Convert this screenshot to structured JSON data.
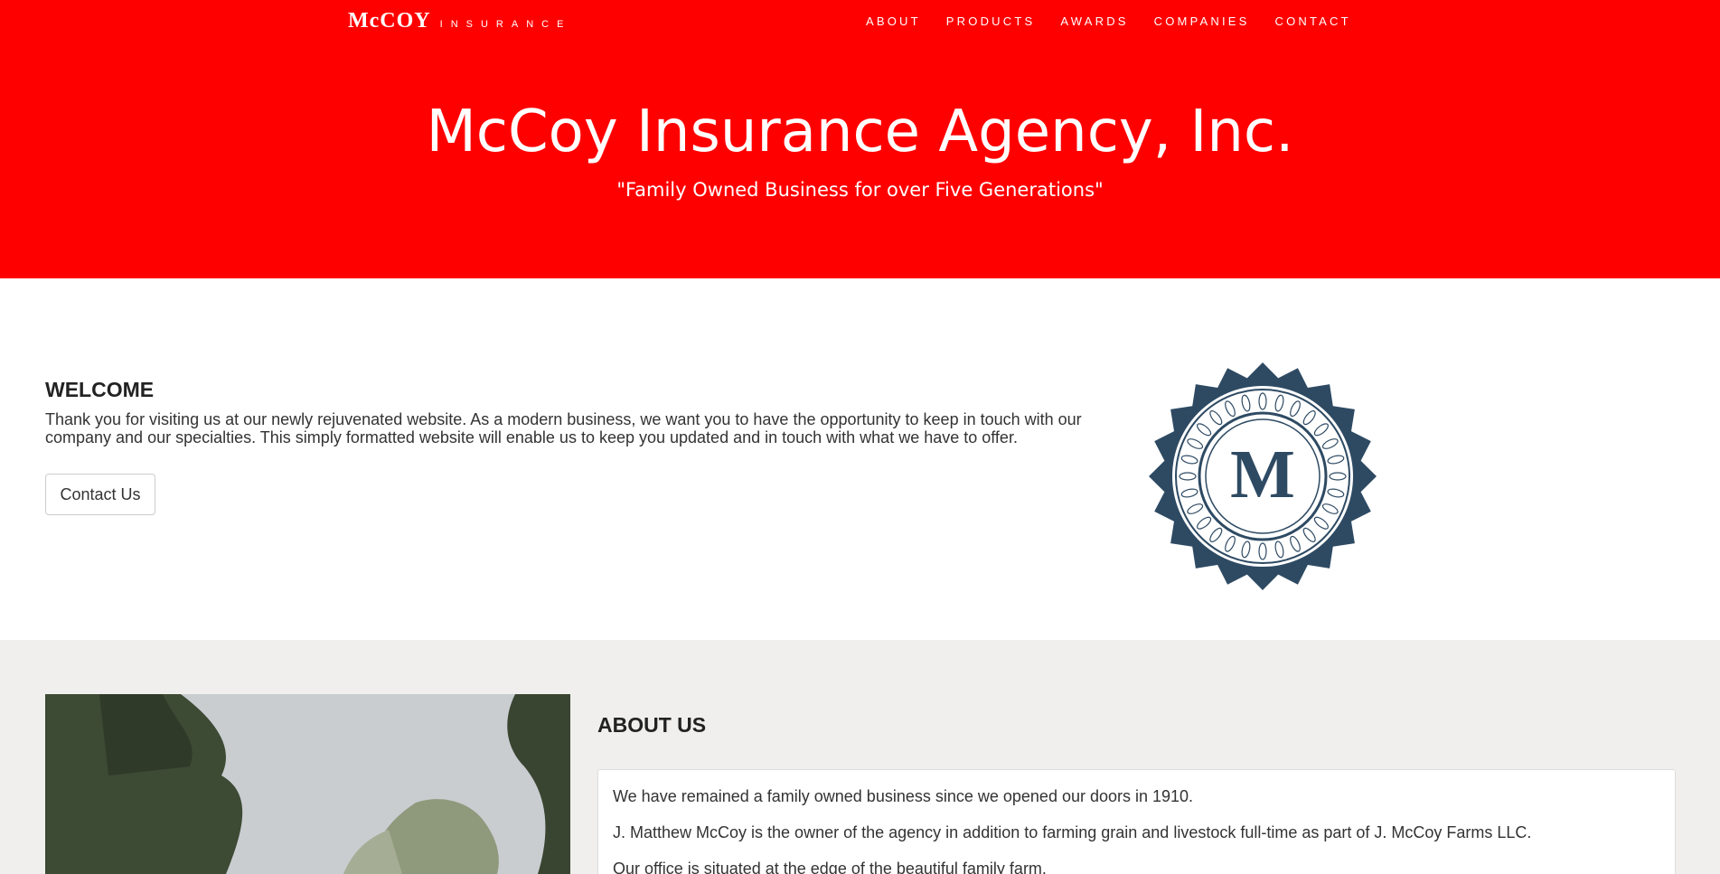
{
  "header": {
    "logo_mccoy": "McCOY",
    "logo_insurance": "INSURANCE",
    "nav": [
      {
        "label": "ABOUT"
      },
      {
        "label": "PRODUCTS"
      },
      {
        "label": "AWARDS"
      },
      {
        "label": "COMPANIES"
      },
      {
        "label": "CONTACT"
      }
    ]
  },
  "hero": {
    "title": "McCoy Insurance Agency, Inc.",
    "subtitle": "\"Family Owned Business for over Five Generations\""
  },
  "welcome": {
    "heading": "WELCOME",
    "text": "Thank you for visiting us at our newly rejuvenated website. As a modern business, we want you to have the opportunity to keep in touch with our company and our specialties. This simply formatted website will enable us to keep you updated and in touch with what we have to offer.",
    "button_label": "Contact Us",
    "seal_letter": "M"
  },
  "about": {
    "heading": "ABOUT US",
    "paragraphs": [
      "We have remained a family owned business since we opened our doors in 1910.",
      "J. Matthew McCoy is the owner of the agency in addition to farming grain and livestock full-time as part of J. McCoy Farms LLC.",
      "Our office is situated at the edge of the beautiful family farm."
    ]
  },
  "colors": {
    "brand_red": "#ff0000",
    "seal_navy": "#2e4a63",
    "about_bg": "#f0efed"
  }
}
